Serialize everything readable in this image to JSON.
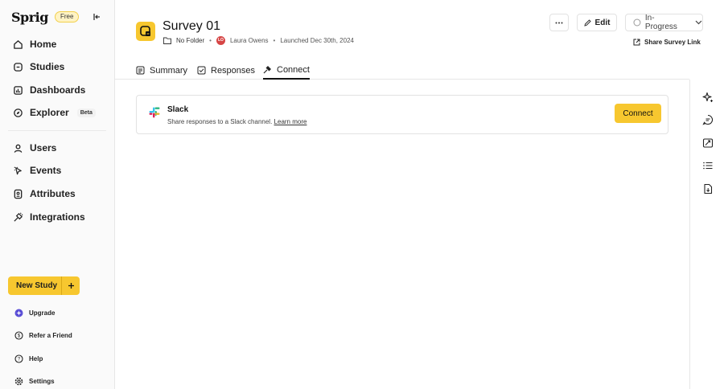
{
  "sidebar": {
    "logo": "Sprig",
    "plan_badge": "Free",
    "nav": [
      {
        "label": "Home",
        "icon": "home-icon"
      },
      {
        "label": "Studies",
        "icon": "studies-icon"
      },
      {
        "label": "Dashboards",
        "icon": "dashboards-icon"
      },
      {
        "label": "Explorer",
        "icon": "explorer-icon",
        "badge": "Beta"
      },
      {
        "label": "Users",
        "icon": "users-icon"
      },
      {
        "label": "Events",
        "icon": "events-icon"
      },
      {
        "label": "Attributes",
        "icon": "attributes-icon"
      },
      {
        "label": "Integrations",
        "icon": "integrations-icon"
      }
    ],
    "new_study_label": "New Study",
    "footer": [
      {
        "label": "Upgrade",
        "icon": "upgrade-icon"
      },
      {
        "label": "Refer a Friend",
        "icon": "refer-icon"
      },
      {
        "label": "Help",
        "icon": "help-icon"
      },
      {
        "label": "Settings",
        "icon": "settings-icon"
      }
    ]
  },
  "header": {
    "title": "Survey 01",
    "folder": "No Folder",
    "owner_initials": "LO",
    "owner_name": "Laura Owens",
    "launched": "Launched Dec 30th, 2024",
    "edit_label": "Edit",
    "status": "In-Progress",
    "share_label": "Share Survey Link"
  },
  "tabs": [
    {
      "label": "Summary",
      "icon": "summary-icon"
    },
    {
      "label": "Responses",
      "icon": "responses-icon"
    },
    {
      "label": "Connect",
      "icon": "connect-icon",
      "active": true
    }
  ],
  "integration": {
    "name": "Slack",
    "description": "Share responses to a Slack channel.",
    "link": "Learn more",
    "button": "Connect"
  },
  "rail_icons": [
    "sparkle-icon",
    "chat-icon",
    "screen-icon",
    "list-icon",
    "document-icon"
  ],
  "colors": {
    "accent": "#f7c72f",
    "avatar": "#d64545"
  }
}
